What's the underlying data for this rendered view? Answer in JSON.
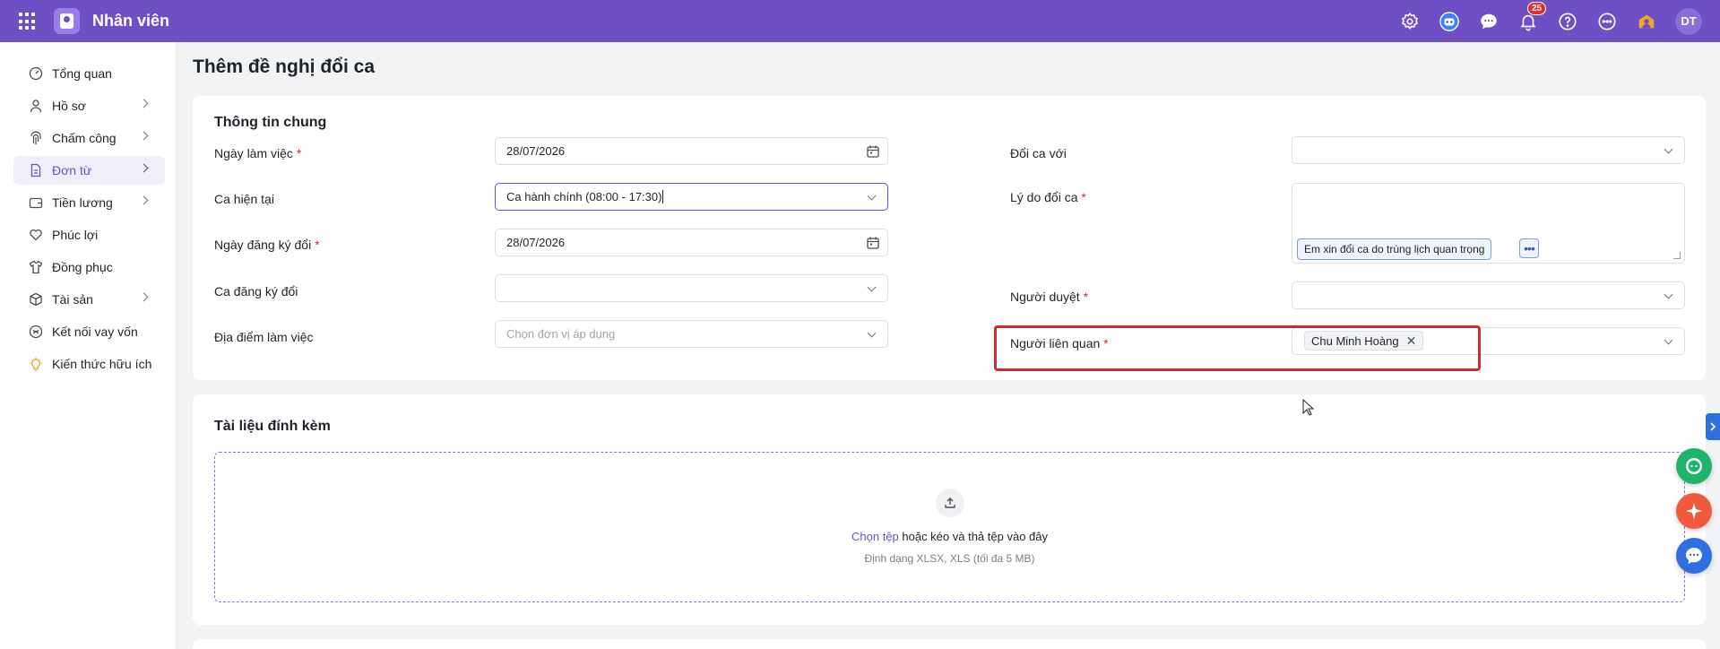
{
  "app": {
    "title": "Nhân viên",
    "notification_count": "25",
    "avatar_initials": "DT",
    "accent_color": "#6e4fc4"
  },
  "sidebar": {
    "items": [
      {
        "label": "Tổng quan",
        "icon": "dashboard-icon",
        "has_children": false
      },
      {
        "label": "Hồ sơ",
        "icon": "user-icon",
        "has_children": true
      },
      {
        "label": "Chấm công",
        "icon": "fingerprint-icon",
        "has_children": true
      },
      {
        "label": "Đơn từ",
        "icon": "document-icon",
        "has_children": true,
        "active": true
      },
      {
        "label": "Tiền lương",
        "icon": "wallet-icon",
        "has_children": true
      },
      {
        "label": "Phúc lợi",
        "icon": "heart-hand-icon",
        "has_children": false
      },
      {
        "label": "Đồng phục",
        "icon": "shirt-icon",
        "has_children": false
      },
      {
        "label": "Tài sản",
        "icon": "box-icon",
        "has_children": true
      },
      {
        "label": "Kết nối vay vốn",
        "icon": "link-circle-icon",
        "has_children": false
      },
      {
        "label": "Kiến thức hữu ích",
        "icon": "lightbulb-icon",
        "has_children": false
      }
    ]
  },
  "page": {
    "title": "Thêm đề nghị đổi ca"
  },
  "general": {
    "section_title": "Thông tin chung",
    "work_date_label": "Ngày làm việc",
    "work_date_value": "28/07/2026",
    "current_shift_label": "Ca hiện tại",
    "current_shift_value": "Ca hành chính (08:00 - 17:30)",
    "register_date_label": "Ngày đăng ký đổi",
    "register_date_value": "28/07/2026",
    "register_shift_label": "Ca đăng ký đổi",
    "register_shift_value": "",
    "location_label": "Địa điểm làm việc",
    "location_placeholder": "Chọn đơn vị áp dụng",
    "swap_with_label": "Đổi ca với",
    "swap_with_value": "",
    "reason_label": "Lý do đổi ca",
    "reason_suggestion": "Em xin đổi ca do trùng lịch quan trọng",
    "approver_label": "Người duyệt",
    "approver_value": "",
    "related_label": "Người liên quan",
    "related_tag": "Chu Minh Hoàng",
    "required_mark": "*"
  },
  "attachments": {
    "section_title": "Tài liệu đính kèm",
    "choose_file": "Chọn tệp",
    "drag_text": " hoặc kéo và thả tệp vào đây",
    "format_hint": "Định dạng XLSX, XLS (tối đa 5 MB)"
  }
}
